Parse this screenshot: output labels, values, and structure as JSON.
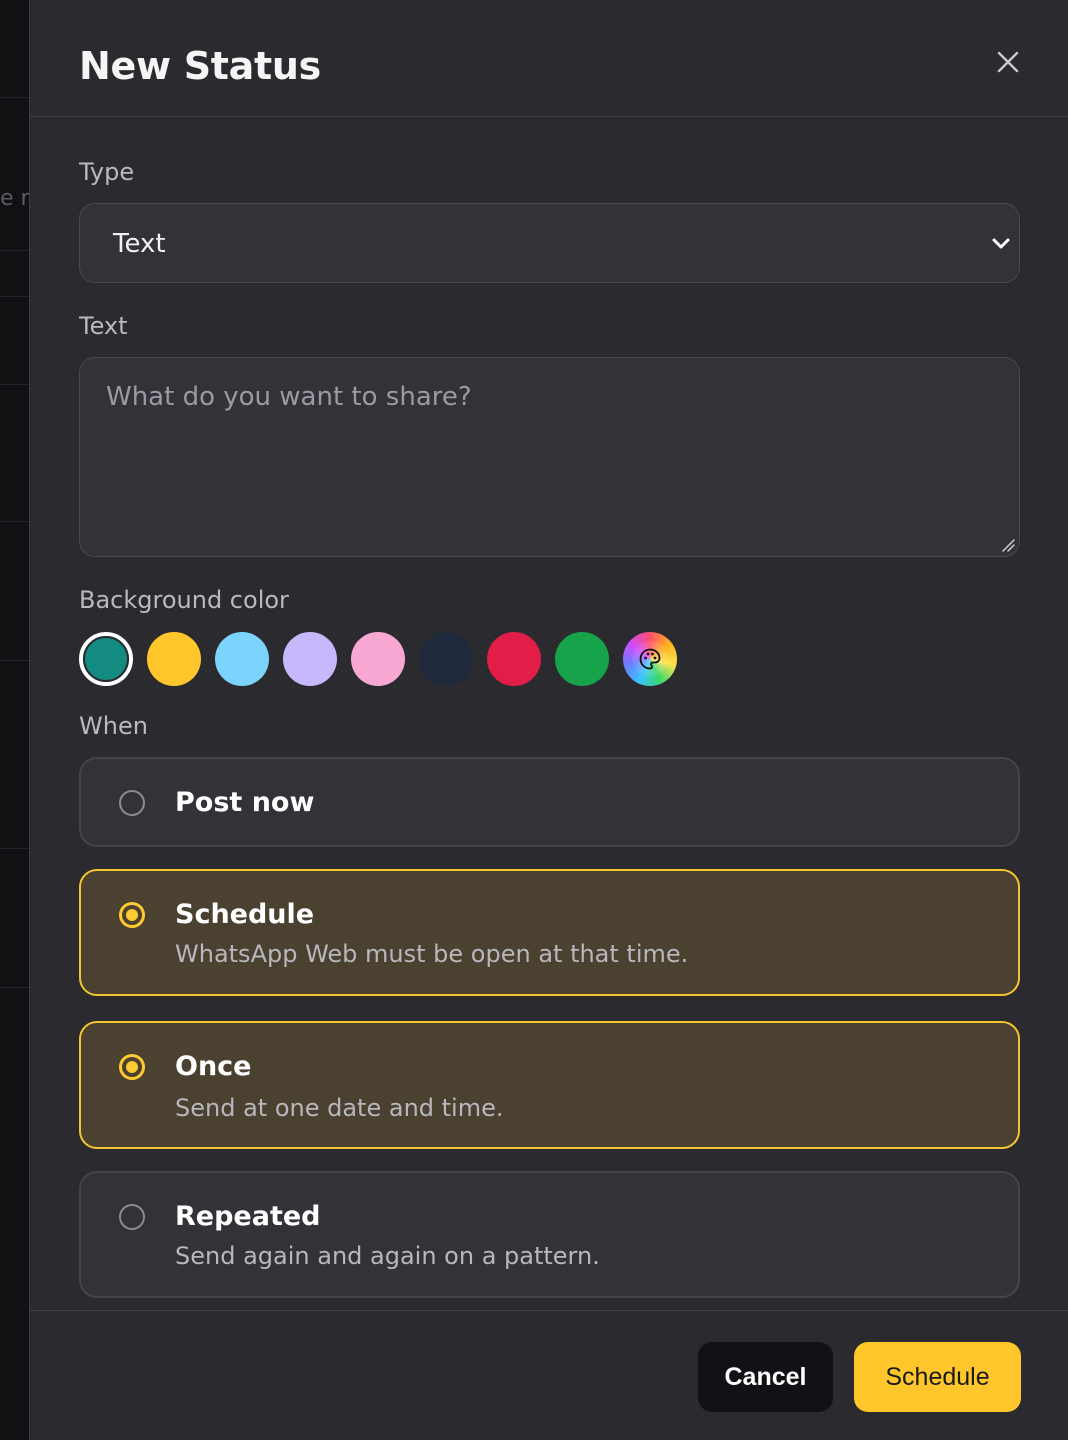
{
  "background_fragment": "e r",
  "dialog": {
    "title": "New Status",
    "close_icon": "close-icon"
  },
  "type_field": {
    "label": "Type",
    "value": "Text",
    "icon": "chevron-down-icon"
  },
  "text_field": {
    "label": "Text",
    "placeholder": "What do you want to share?",
    "value": ""
  },
  "background_color": {
    "label": "Background color",
    "selected": "teal",
    "swatches": [
      {
        "name": "teal",
        "color": "#138b80"
      },
      {
        "name": "yellow",
        "color": "#ffc72c"
      },
      {
        "name": "light-blue",
        "color": "#7cd3fc"
      },
      {
        "name": "lavender",
        "color": "#c7b8fc"
      },
      {
        "name": "pink",
        "color": "#f9a8d4"
      },
      {
        "name": "navy",
        "color": "#1e293b"
      },
      {
        "name": "red",
        "color": "#e11d48"
      },
      {
        "name": "green",
        "color": "#16a34a"
      },
      {
        "name": "custom",
        "icon": "palette-icon"
      }
    ]
  },
  "when": {
    "label": "When",
    "options": [
      {
        "title": "Post now",
        "subtitle": "",
        "selected": false
      },
      {
        "title": "Schedule",
        "subtitle": "WhatsApp Web must be open at that time.",
        "selected": true
      },
      {
        "title": "Once",
        "subtitle": "Send at one date and time.",
        "selected": true
      },
      {
        "title": "Repeated",
        "subtitle": "Send again and again on a pattern.",
        "selected": false
      }
    ]
  },
  "footer": {
    "cancel_label": "Cancel",
    "submit_label": "Schedule"
  },
  "colors": {
    "accent": "#ffc72c",
    "panel": "#2a2a2f",
    "field": "#323238",
    "active_option": "#4a4130"
  }
}
